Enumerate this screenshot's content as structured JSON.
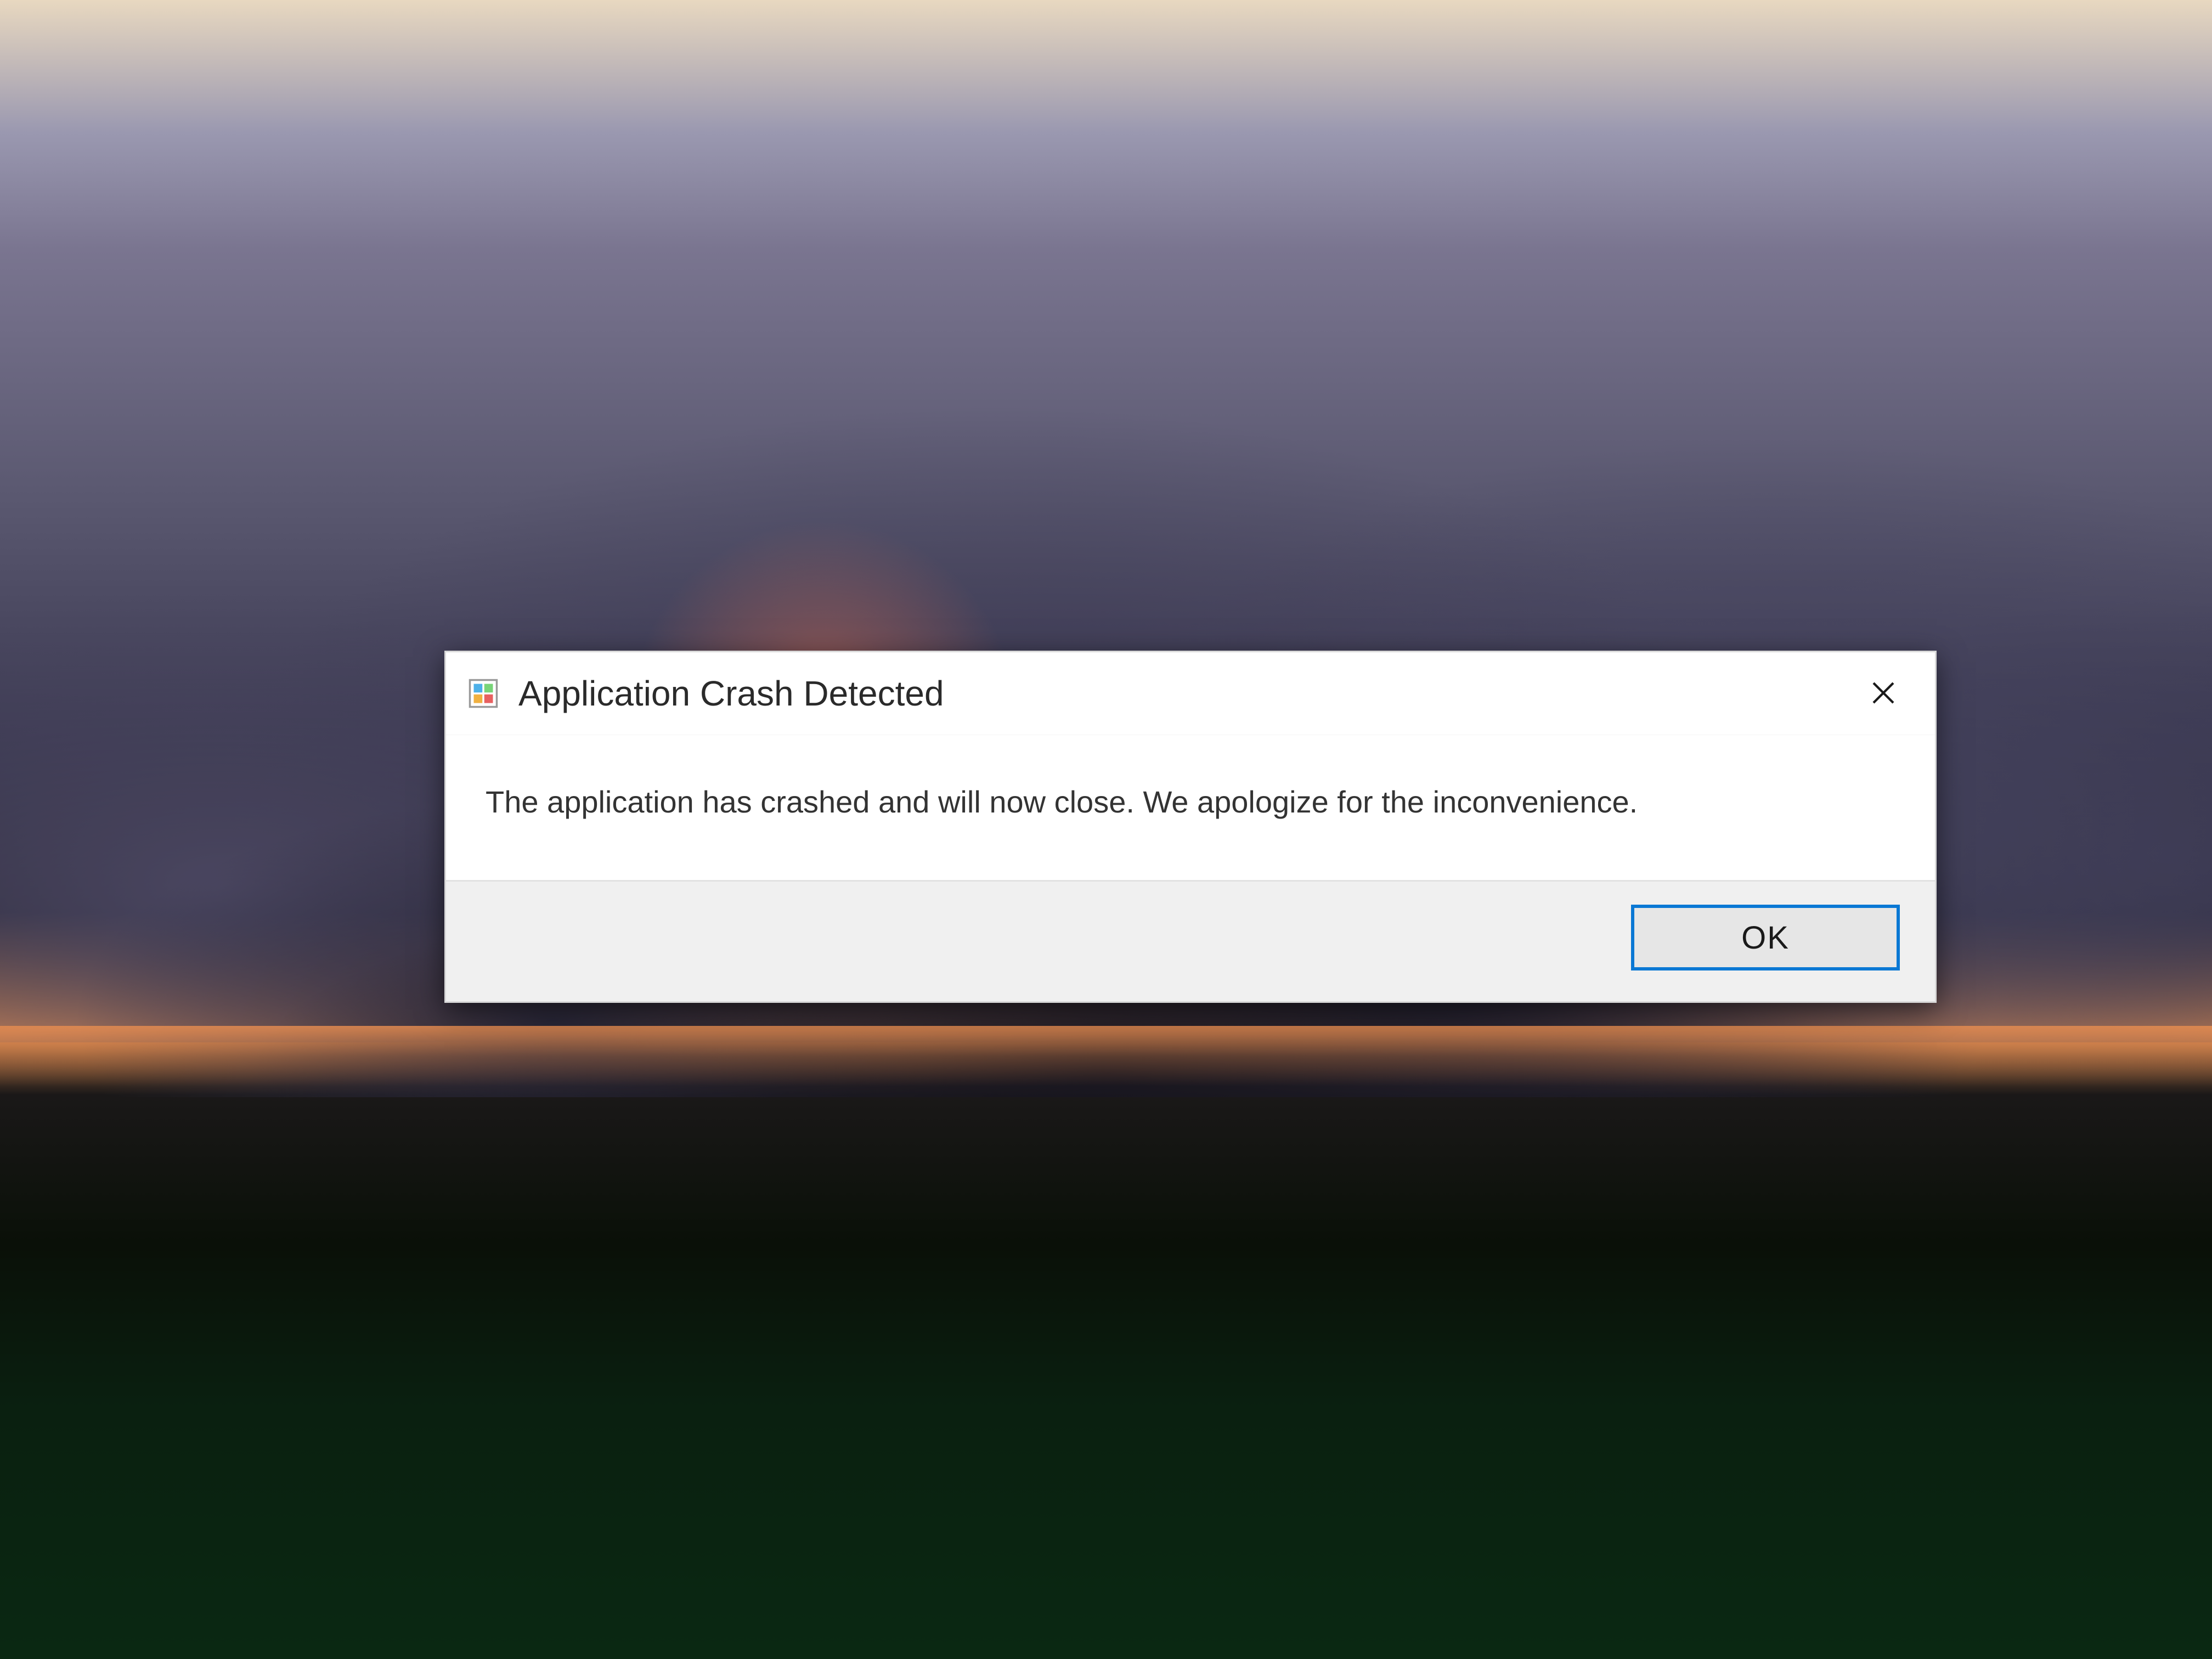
{
  "dialog": {
    "title": "Application Crash Detected",
    "message": "The application has crashed and will now close. We apologize for the inconvenience.",
    "ok_label": "OK"
  }
}
